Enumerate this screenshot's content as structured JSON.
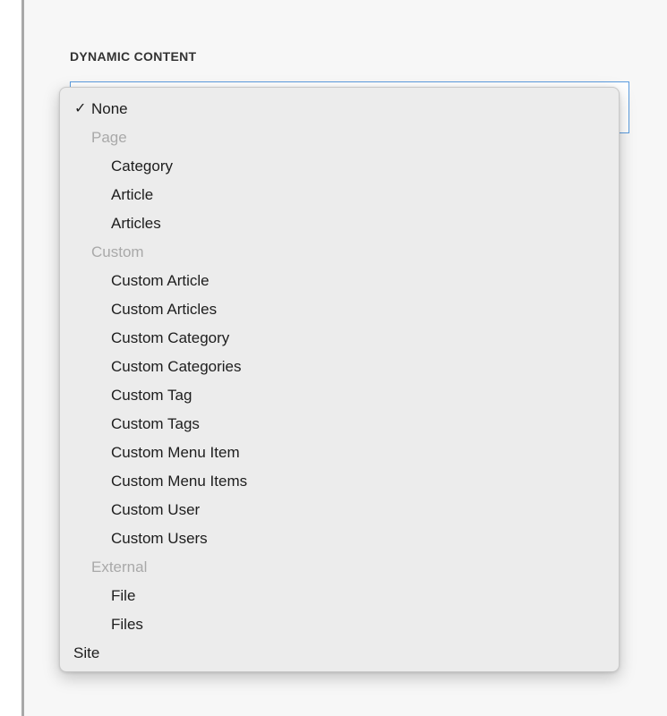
{
  "field": {
    "label": "DYNAMIC CONTENT"
  },
  "dropdown": {
    "selected": "None",
    "check_glyph": "✓",
    "options": [
      {
        "label": "None",
        "type": "option",
        "level": 0,
        "checked": true
      },
      {
        "label": "Page",
        "type": "group"
      },
      {
        "label": "Category",
        "type": "option",
        "level": 1
      },
      {
        "label": "Article",
        "type": "option",
        "level": 1
      },
      {
        "label": "Articles",
        "type": "option",
        "level": 1
      },
      {
        "label": "Custom",
        "type": "group"
      },
      {
        "label": "Custom Article",
        "type": "option",
        "level": 1
      },
      {
        "label": "Custom Articles",
        "type": "option",
        "level": 1
      },
      {
        "label": "Custom Category",
        "type": "option",
        "level": 1
      },
      {
        "label": "Custom Categories",
        "type": "option",
        "level": 1
      },
      {
        "label": "Custom Tag",
        "type": "option",
        "level": 1
      },
      {
        "label": "Custom Tags",
        "type": "option",
        "level": 1
      },
      {
        "label": "Custom Menu Item",
        "type": "option",
        "level": 1
      },
      {
        "label": "Custom Menu Items",
        "type": "option",
        "level": 1
      },
      {
        "label": "Custom User",
        "type": "option",
        "level": 1
      },
      {
        "label": "Custom Users",
        "type": "option",
        "level": 1
      },
      {
        "label": "External",
        "type": "group"
      },
      {
        "label": "File",
        "type": "option",
        "level": 1
      },
      {
        "label": "Files",
        "type": "option",
        "level": 1
      },
      {
        "label": "Site",
        "type": "option",
        "level": 0
      }
    ]
  },
  "colors": {
    "focus_border": "#5b9cdf",
    "menu_background": "#ececec",
    "group_text": "#a9a9a9"
  }
}
